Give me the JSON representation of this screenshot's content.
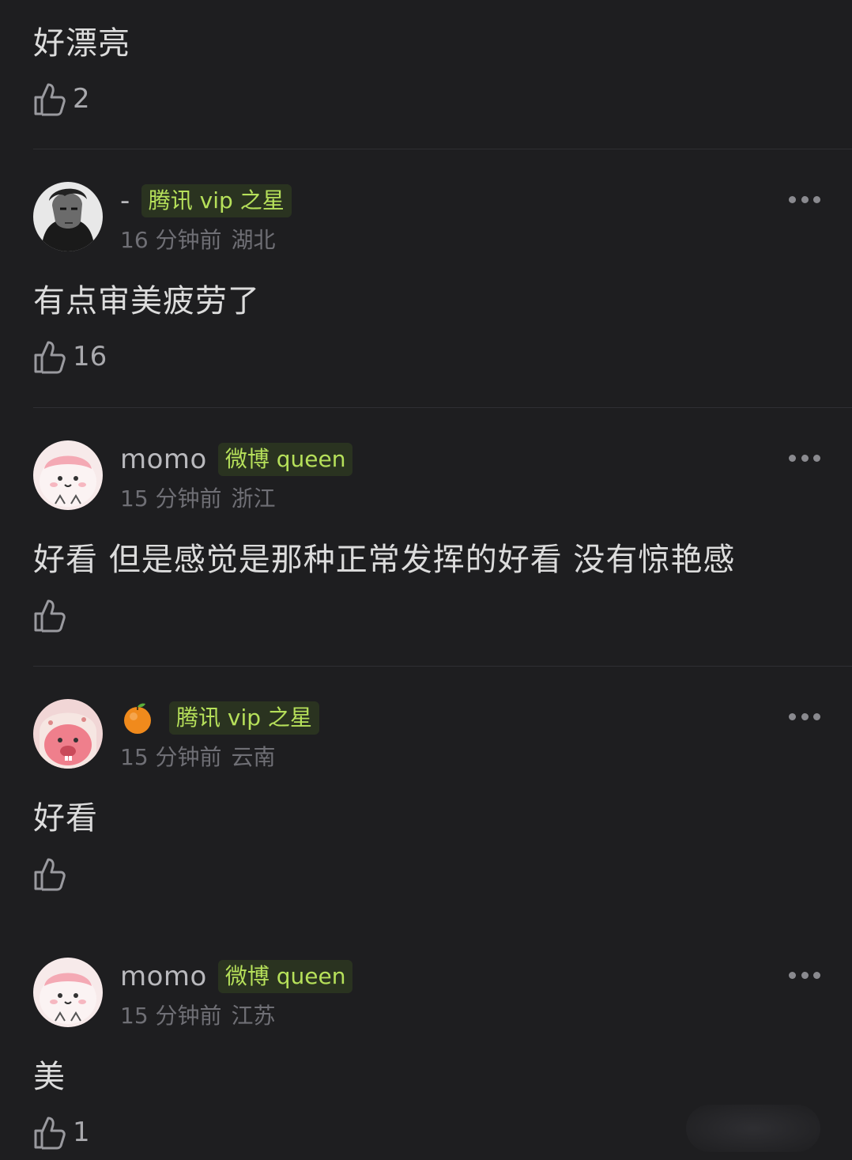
{
  "comments": [
    {
      "text": "好漂亮",
      "likes": "2"
    },
    {
      "username": "-",
      "badge": "腾讯 vip 之星",
      "time": "16 分钟前",
      "location": "湖北",
      "text": "有点审美疲劳了",
      "likes": "16"
    },
    {
      "username": "momo",
      "badge": "微博 queen",
      "time": "15 分钟前",
      "location": "浙江",
      "text": "好看 但是感觉是那种正常发挥的好看 没有惊艳感",
      "likes": ""
    },
    {
      "username_icon": "orange-icon",
      "badge": "腾讯 vip 之星",
      "time": "15 分钟前",
      "location": "云南",
      "text": "好看",
      "likes": ""
    },
    {
      "username": "momo",
      "badge": "微博 queen",
      "time": "15 分钟前",
      "location": "江苏",
      "text": "美",
      "likes": "1"
    }
  ],
  "colors": {
    "background": "#1e1e20",
    "badge_text": "#b6e05a",
    "badge_bg": "#2a3320",
    "meta": "#6f6f75"
  }
}
